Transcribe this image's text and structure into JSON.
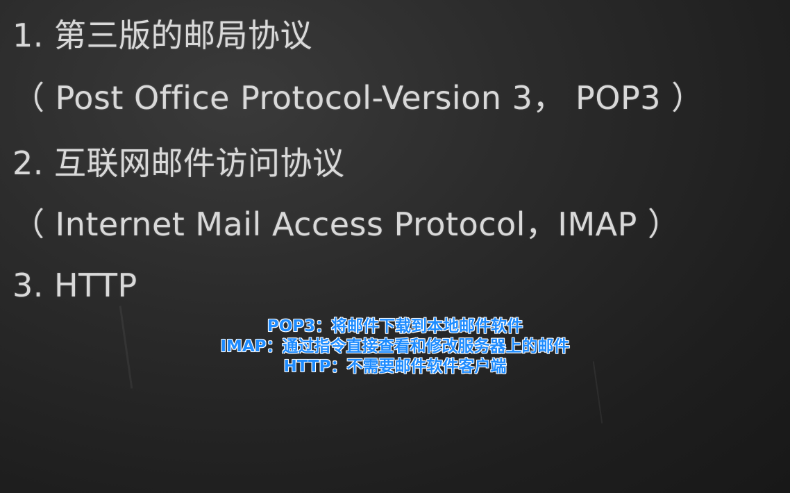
{
  "board": {
    "lines": [
      "1. 第三版的邮局协议",
      "（ Post Office Protocol-Version 3， POP3 ）",
      "2. 互联网邮件访问协议",
      "（ Internet Mail Access Protocol，IMAP ）",
      "3. HTTP"
    ]
  },
  "subtitles": [
    "POP3：将邮件下载到本地邮件软件",
    "IMAP：通过指令直接查看和修改服务器上的邮件",
    "HTTP：不需要邮件软件客户端"
  ],
  "colors": {
    "background": "#2a2a2a",
    "chalk_text": "#d9d9d9",
    "subtitle_text": "#1e8cff",
    "subtitle_outline": "#ffffff"
  }
}
